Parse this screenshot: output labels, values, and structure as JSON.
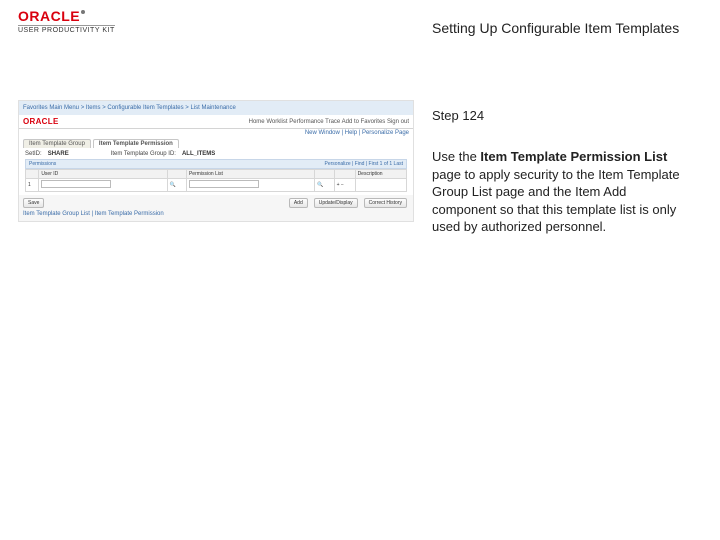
{
  "brand": {
    "name": "ORACLE",
    "kit": "USER PRODUCTIVITY KIT"
  },
  "title": "Setting Up Configurable Item Templates",
  "step": "Step 124",
  "paragraph": {
    "lead": "Use the ",
    "bold": "Item Template Permission List",
    "rest": " page to apply security to the Item Template Group List page and the Item Add component so that this template list is only used by authorized personnel."
  },
  "mini": {
    "top_left": "Favorites   Main Menu > Items > Configurable Item Templates > List Maintenance",
    "top_right": [
      "Home",
      "Worklist",
      "Performance Trace",
      "Add to Favorites",
      "Sign out"
    ],
    "oracle": "ORACLE",
    "new_window": "New Window | Help | Personalize Page",
    "tabs": [
      "Item Template Group",
      "Item Template Permission"
    ],
    "setid_lbl": "SetID:",
    "setid_val": "SHARE",
    "group_lbl": "Item Template Group ID:",
    "group_val": "ALL_ITEMS",
    "gridbar_left": "Permissions",
    "gridbar_right": "Personalize | Find |  First 1 of 1 Last",
    "cols": [
      "",
      "User ID",
      "",
      "Permission List",
      "",
      "",
      "Description"
    ],
    "row": [
      "1",
      "",
      "",
      "",
      "",
      "",
      ""
    ],
    "save": "Save",
    "footer_links": "Item Template Group List | Item Template Permission",
    "actions": [
      "Add",
      "Update/Display",
      "Correct History"
    ]
  }
}
